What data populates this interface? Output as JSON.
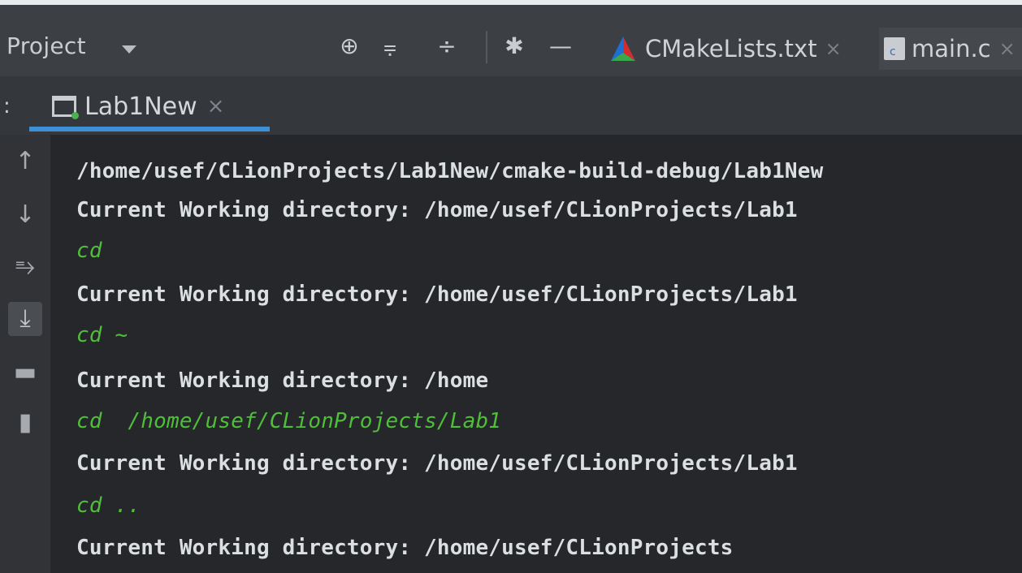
{
  "toolbar": {
    "project_label": "Project",
    "icons": [
      "crosshair-icon",
      "collapse-all-icon",
      "expand-all-icon",
      "gear-icon",
      "minimize-icon"
    ]
  },
  "editor_tabs": [
    {
      "label": "CMakeLists.txt",
      "icon": "cmake-icon"
    },
    {
      "label": "main.c",
      "icon": "c-file-icon"
    }
  ],
  "run_panel": {
    "tab_label": "Lab1New",
    "close_glyph": "×"
  },
  "gutter_icons": [
    "arrow-up-icon",
    "arrow-down-icon",
    "soft-wrap-icon",
    "scroll-to-end-icon",
    "print-icon",
    "trash-icon"
  ],
  "console": {
    "lines": [
      {
        "text": "/home/usef/CLionProjects/Lab1New/cmake-build-debug/Lab1New",
        "type": "output"
      },
      {
        "text": "Current Working directory: /home/usef/CLionProjects/Lab1",
        "type": "output"
      },
      {
        "text": "cd",
        "type": "input"
      },
      {
        "text": "Current Working directory: /home/usef/CLionProjects/Lab1",
        "type": "output"
      },
      {
        "text": "cd ~",
        "type": "input"
      },
      {
        "text": "Current Working directory: /home",
        "type": "output"
      },
      {
        "text": "cd  /home/usef/CLionProjects/Lab1",
        "type": "input"
      },
      {
        "text": "Current Working directory: /home/usef/CLionProjects/Lab1",
        "type": "output"
      },
      {
        "text": "cd ..",
        "type": "input"
      },
      {
        "text": "Current Working directory: /home/usef/CLionProjects",
        "type": "output"
      }
    ]
  },
  "colors": {
    "output_text": "#dcdfe2",
    "input_text": "#4fbf3a",
    "accent": "#3d8fd6",
    "background": "#25272a"
  }
}
